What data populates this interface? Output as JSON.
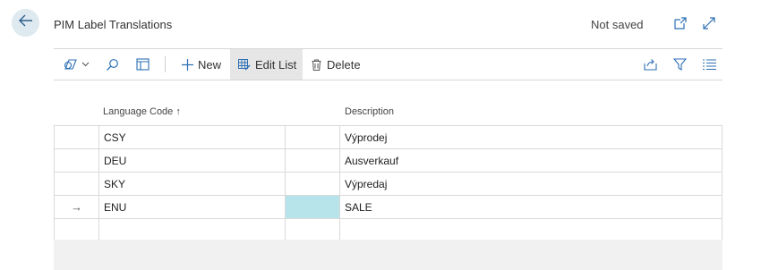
{
  "header": {
    "title": "PIM Label Translations",
    "save_status": "Not saved"
  },
  "toolbar": {
    "new_label": "New",
    "edit_list_label": "Edit List",
    "delete_label": "Delete"
  },
  "columns": {
    "language_code": "Language Code",
    "sort_indicator": "↑",
    "description": "Description"
  },
  "rows": [
    {
      "indicator": "",
      "language_code": "CSY",
      "description": "Výprodej"
    },
    {
      "indicator": "",
      "language_code": "DEU",
      "description": "Ausverkauf"
    },
    {
      "indicator": "",
      "language_code": "SKY",
      "description": "Výpredaj"
    },
    {
      "indicator": "→",
      "language_code": "ENU",
      "description": "SALE"
    },
    {
      "indicator": "",
      "language_code": "",
      "description": ""
    }
  ],
  "colors": {
    "accent": "#2c6fb4",
    "selected_cell": "#b6e4ea",
    "back_button_bg": "#dfe9f0",
    "active_toolbar_bg": "#e6e6e6"
  }
}
